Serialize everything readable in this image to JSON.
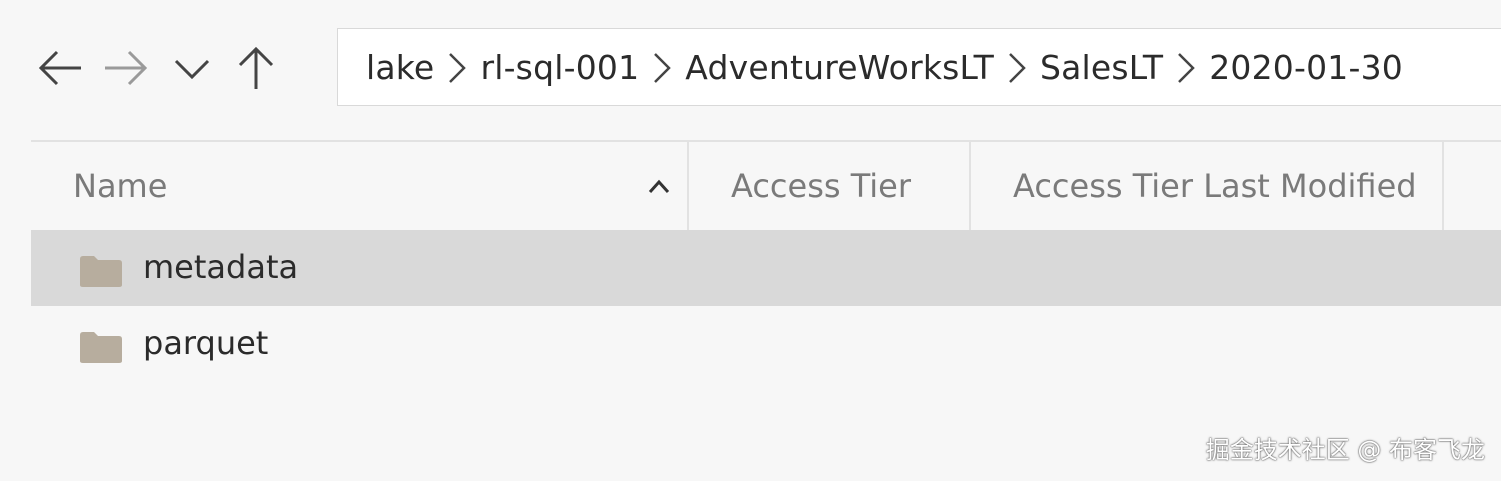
{
  "nav": {
    "back_icon": "arrow-left-icon",
    "forward_icon": "arrow-right-icon",
    "dropdown_icon": "chevron-down-icon",
    "up_icon": "arrow-up-icon"
  },
  "breadcrumb": {
    "items": [
      "lake",
      "rl-sql-001",
      "AdventureWorksLT",
      "SalesLT",
      "2020-01-30"
    ],
    "separator_icon": "chevron-right-icon"
  },
  "columns": {
    "name": "Name",
    "access_tier": "Access Tier",
    "access_tier_last_modified": "Access Tier Last Modified",
    "sort_icon": "sort-ascending-icon"
  },
  "rows": [
    {
      "name": "metadata",
      "icon": "folder-icon",
      "selected": true
    },
    {
      "name": "parquet",
      "icon": "folder-icon",
      "selected": false
    }
  ],
  "colors": {
    "background": "#f7f7f7",
    "selected_row": "#d9d9d9",
    "folder": "#b7ad9e",
    "header_text": "#7a7a7a"
  },
  "watermark": "掘金技术社区 @ 布客飞龙"
}
